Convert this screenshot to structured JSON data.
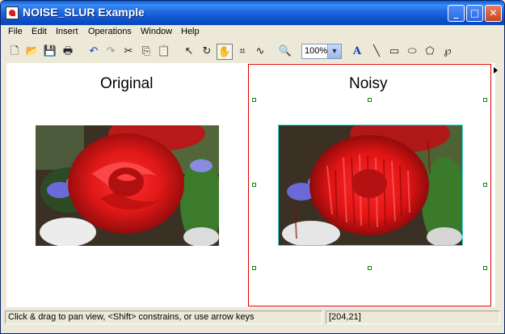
{
  "window": {
    "title": "NOISE_SLUR Example"
  },
  "menu": [
    "File",
    "Edit",
    "Insert",
    "Operations",
    "Window",
    "Help"
  ],
  "toolbar": {
    "zoom_value": "100%"
  },
  "panels": {
    "left_title": "Original",
    "right_title": "Noisy"
  },
  "status": {
    "message": "Click & drag to pan view, <Shift> constrains, or use arrow keys",
    "coords": "[204,21]"
  },
  "colors": {
    "selection_border": "#e00000",
    "handle": "#0a8a0a",
    "image_outline": "#40e0e0"
  }
}
